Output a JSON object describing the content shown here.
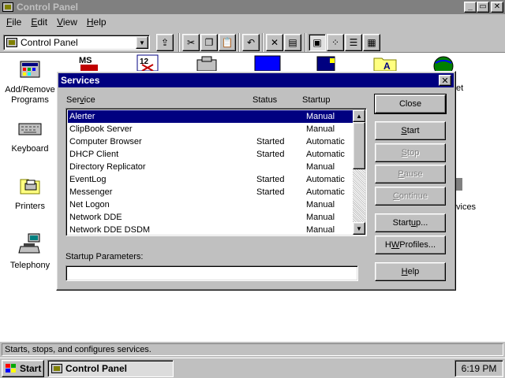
{
  "window": {
    "title": "Control Panel",
    "buttons": {
      "minimize": "_",
      "maximize": "▭",
      "close": "✕"
    }
  },
  "menu": {
    "items": [
      {
        "label": "File",
        "mnemonic": "F",
        "rest": "ile"
      },
      {
        "label": "Edit",
        "mnemonic": "E",
        "rest": "dit"
      },
      {
        "label": "View",
        "mnemonic": "V",
        "rest": "iew"
      },
      {
        "label": "Help",
        "mnemonic": "H",
        "rest": "elp"
      }
    ]
  },
  "toolbar": {
    "address_value": "Control Panel",
    "icons": [
      "up-folder-icon",
      "cut-icon",
      "copy-icon",
      "paste-icon",
      "undo-icon",
      "delete-icon",
      "properties-icon",
      "large-icons-icon",
      "small-icons-icon",
      "list-icon",
      "details-icon"
    ]
  },
  "content": {
    "icons": [
      {
        "label": "Add/Remove Programs"
      },
      {
        "label": "Keyboard"
      },
      {
        "label": "Printers"
      },
      {
        "label": "Telephony"
      }
    ],
    "partial_labels": {
      "right_top": "et",
      "right_mid": "vices"
    }
  },
  "dialog": {
    "title": "Services",
    "close_label": "✕",
    "columns": {
      "service": {
        "mnemonic": "",
        "before": "Ser",
        "underlined": "v",
        "after": "ice"
      },
      "status": "Status",
      "startup": "Startup"
    },
    "services": [
      {
        "name": "Alerter",
        "status": "",
        "startup": "Manual",
        "selected": true
      },
      {
        "name": "ClipBook Server",
        "status": "",
        "startup": "Manual"
      },
      {
        "name": "Computer Browser",
        "status": "Started",
        "startup": "Automatic"
      },
      {
        "name": "DHCP Client",
        "status": "Started",
        "startup": "Automatic"
      },
      {
        "name": "Directory Replicator",
        "status": "",
        "startup": "Manual"
      },
      {
        "name": "EventLog",
        "status": "Started",
        "startup": "Automatic"
      },
      {
        "name": "Messenger",
        "status": "Started",
        "startup": "Automatic"
      },
      {
        "name": "Net Logon",
        "status": "",
        "startup": "Manual"
      },
      {
        "name": "Network DDE",
        "status": "",
        "startup": "Manual"
      },
      {
        "name": "Network DDE DSDM",
        "status": "",
        "startup": "Manual"
      }
    ],
    "startup_parameters": {
      "before": "",
      "underlined": "",
      "label": "Startup Parameters:",
      "value": ""
    },
    "buttons": {
      "close": "Close",
      "start": {
        "u": "S",
        "rest": "tart"
      },
      "stop": {
        "u": "S",
        "rest": "top"
      },
      "pause": {
        "u": "P",
        "rest": "ause"
      },
      "continue": {
        "u": "C",
        "rest": "ontinue"
      },
      "startup": {
        "before": "Start",
        "u": "u",
        "after": "p..."
      },
      "hw_profiles": {
        "before": "H",
        "u": "W",
        "after": " Profiles..."
      },
      "help": {
        "u": "H",
        "rest": "elp"
      }
    },
    "disabled": [
      "Stop",
      "Pause",
      "Continue"
    ]
  },
  "statusbar": {
    "text": "Starts, stops, and configures services."
  },
  "taskbar": {
    "start_label": "Start",
    "task_label": "Control Panel",
    "clock": "6:19 PM"
  },
  "colors": {
    "title_active": "#000080",
    "title_inactive": "#808080",
    "face": "#c0c0c0"
  }
}
